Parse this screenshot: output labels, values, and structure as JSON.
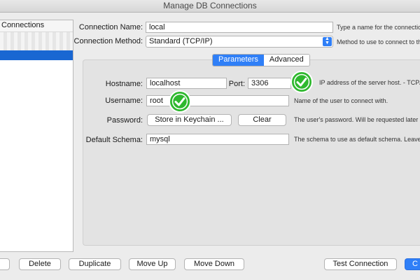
{
  "window": {
    "title": "Manage DB Connections"
  },
  "sidebar": {
    "header": "Connections"
  },
  "form": {
    "connection_name_label": "Connection Name:",
    "connection_name_value": "local",
    "connection_name_hint": "Type a name for the connection",
    "connection_method_label": "Connection Method:",
    "connection_method_value": "Standard (TCP/IP)",
    "connection_method_hint": "Method to use to connect to the"
  },
  "tabs": {
    "parameters": "Parameters",
    "advanced": "Advanced"
  },
  "params": {
    "hostname_label": "Hostname:",
    "hostname_value": "localhost",
    "port_label": "Port:",
    "port_value": "3306",
    "hostname_hint": "IP address of the server host. - TCP/IP",
    "username_label": "Username:",
    "username_value": "root",
    "username_hint": "Name of the user to connect with.",
    "password_label": "Password:",
    "store_keychain": "Store in Keychain ...",
    "clear": "Clear",
    "password_hint": "The user's password. Will be requested later if n",
    "schema_label": "Default Schema:",
    "schema_value": "mysql",
    "schema_hint": "The schema to use as default schema. Leave bl"
  },
  "buttons": {
    "delete": "Delete",
    "duplicate": "Duplicate",
    "move_up": "Move Up",
    "move_down": "Move Down",
    "test_connection": "Test Connection",
    "close_partial": "C"
  },
  "colors": {
    "accent": "#2f7ff7",
    "check_green": "#2eb82e"
  },
  "icons": {
    "checkmark": "checkmark-icon",
    "select_arrows": "chevron-updown-icon"
  }
}
